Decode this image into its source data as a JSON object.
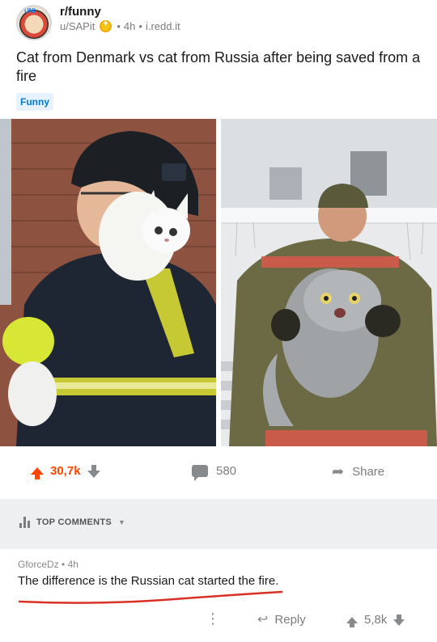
{
  "post": {
    "subreddit": "r/funny",
    "avatar_badge": "UNI",
    "author": "u/SAPit",
    "age": "4h",
    "domain": "i.redd.it",
    "separator": "•",
    "title": "Cat from Denmark vs cat from Russia after being saved from a fire",
    "flair": "Funny"
  },
  "actions": {
    "score": "30,7k",
    "comments": "580",
    "share": "Share"
  },
  "top_comments": {
    "label": "TOP COMMENTS",
    "caret": "▼"
  },
  "comment": {
    "author": "GforceDz",
    "age": "4h",
    "separator": "•",
    "body": "The difference is the Russian cat started the fire.",
    "reply": "Reply",
    "score": "5,8k",
    "more": "⋮"
  },
  "colors": {
    "accent": "#ff4500",
    "flair_text": "#0079d3",
    "flair_bg": "#e6f3ff",
    "underline": "#d93025"
  },
  "icons": [
    "upvote-icon",
    "downvote-icon",
    "comment-icon",
    "share-icon",
    "reply-icon",
    "award-icon",
    "top-comments-icon"
  ]
}
